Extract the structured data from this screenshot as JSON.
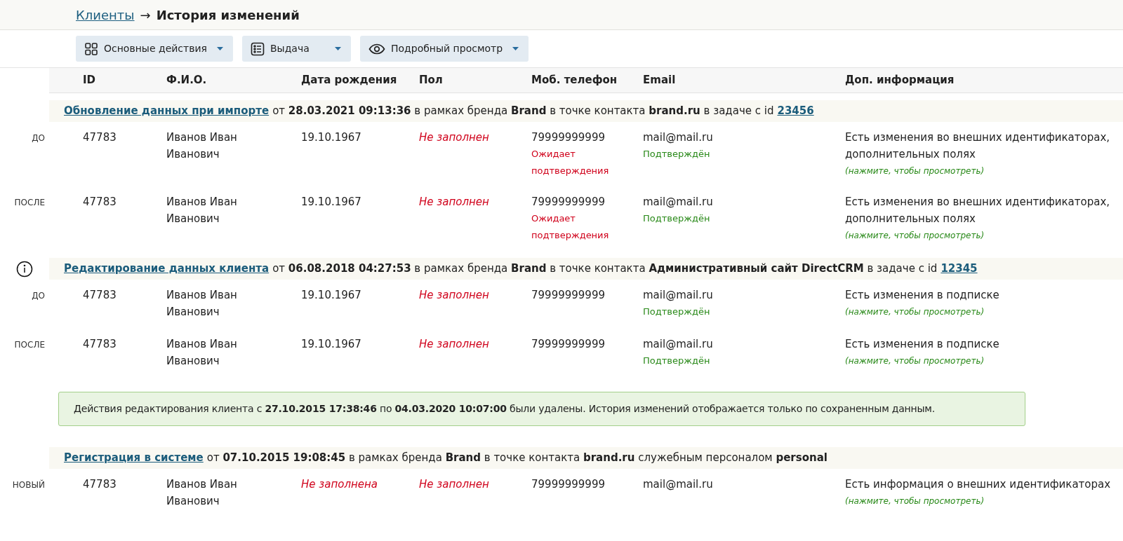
{
  "breadcrumb": {
    "link": "Клиенты",
    "separator": "→",
    "current": "История изменений"
  },
  "toolbar": [
    {
      "label": "Основные действия",
      "kind": "grid"
    },
    {
      "label": "Выдача",
      "kind": "list"
    },
    {
      "label": "Подробный просмотр",
      "kind": "eye"
    }
  ],
  "table": {
    "columns": [
      "ID",
      "Ф.И.О.",
      "Дата рождения",
      "Пол",
      "Моб. телефон",
      "Email",
      "Доп. информация"
    ]
  },
  "sections": [
    {
      "kind": "event",
      "info": false,
      "title_link": "Обновление данных при импорте",
      "description": "от **28.03.2021 09:13:36** в рамках бренда **Brand** в точке контакта **brand.ru** в задаче с id",
      "task_link": "23456",
      "rows": [
        {
          "label": "ДО",
          "id": "47783",
          "name": "Иванов Иван Иванович",
          "birth_date": {
            "text": "19.10.1967",
            "empty": false
          },
          "gender": {
            "text": "Не заполнен",
            "empty": true
          },
          "phone": {
            "text": "79999999999",
            "status": {
              "text": "Ожидает подтверждения",
              "kind": "pending"
            }
          },
          "email": {
            "text": "mail@mail.ru",
            "status": {
              "text": "Подтверждён",
              "kind": "confirmed"
            }
          },
          "info": {
            "text": "Есть изменения во внешних идентификаторах, дополнительных полях",
            "hint": "(нажмите, чтобы просмотреть)"
          }
        },
        {
          "label": "ПОСЛЕ",
          "id": "47783",
          "name": "Иванов Иван Иванович",
          "birth_date": {
            "text": "19.10.1967",
            "empty": false
          },
          "gender": {
            "text": "Не заполнен",
            "empty": true
          },
          "phone": {
            "text": "79999999999",
            "status": {
              "text": "Ожидает подтверждения",
              "kind": "pending"
            }
          },
          "email": {
            "text": "mail@mail.ru",
            "status": {
              "text": "Подтверждён",
              "kind": "confirmed"
            }
          },
          "info": {
            "text": "Есть изменения во внешних идентификаторах, дополнительных полях",
            "hint": "(нажмите, чтобы просмотреть)"
          }
        }
      ]
    },
    {
      "kind": "event",
      "info": true,
      "title_link": "Редактирование данных клиента",
      "description": "от **06.08.2018 04:27:53** в рамках бренда **Brand** в точке контакта **Административный сайт DirectCRM** в задаче с id",
      "task_link": "12345",
      "rows": [
        {
          "label": "ДО",
          "id": "47783",
          "name": "Иванов Иван Иванович",
          "birth_date": {
            "text": "19.10.1967",
            "empty": false
          },
          "gender": {
            "text": "Не заполнен",
            "empty": true
          },
          "phone": {
            "text": "79999999999"
          },
          "email": {
            "text": "mail@mail.ru",
            "status": {
              "text": "Подтверждён",
              "kind": "confirmed"
            }
          },
          "info": {
            "text": "Есть изменения в подписке",
            "hint": "(нажмите, чтобы просмотреть)"
          }
        },
        {
          "label": "ПОСЛЕ",
          "id": "47783",
          "name": "Иванов Иван Иванович",
          "birth_date": {
            "text": "19.10.1967",
            "empty": false
          },
          "gender": {
            "text": "Не заполнен",
            "empty": true
          },
          "phone": {
            "text": "79999999999"
          },
          "email": {
            "text": "mail@mail.ru",
            "status": {
              "text": "Подтверждён",
              "kind": "confirmed"
            }
          },
          "info": {
            "text": "Есть изменения в подписке",
            "hint": "(нажмите, чтобы просмотреть)"
          }
        }
      ]
    },
    {
      "kind": "notice",
      "text": "Действия редактирования клиента с **27.10.2015 17:38:46** по **04.03.2020 10:07:00** были удалены. История изменений отображается только по сохраненным данным."
    },
    {
      "kind": "event",
      "info": false,
      "title_link": "Регистрация в системе",
      "description": "от **07.10.2015 19:08:45** в рамках бренда **Brand** в точке контакта **brand.ru** служебным персоналом **personal**",
      "rows": [
        {
          "label": "НОВЫЙ",
          "id": "47783",
          "name": "Иванов Иван Иванович",
          "birth_date": {
            "text": "Не заполнена",
            "empty": true
          },
          "gender": {
            "text": "Не заполнен",
            "empty": true
          },
          "phone": {
            "text": "79999999999"
          },
          "email": {
            "text": "mail@mail.ru"
          },
          "info": {
            "text": "Есть информация о внешних идентификаторах",
            "hint": "(нажмите, чтобы просмотреть)"
          }
        }
      ]
    }
  ]
}
